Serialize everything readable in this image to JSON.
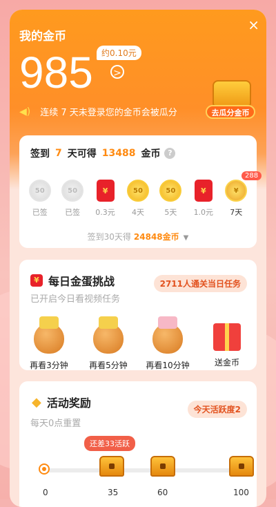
{
  "header": {
    "title": "我的金币",
    "coin_count": "985",
    "approx_value": "约0.10元",
    "arrow": ">",
    "warning": "连续 7 天未登录您的金币会被瓜分",
    "close": "×",
    "chest_button": "去瓜分金币"
  },
  "signin": {
    "prefix": "签到",
    "days": "7",
    "middle": "天可得",
    "amount": "13488",
    "unit": "金币",
    "help": "?",
    "badge": "288",
    "items": [
      {
        "icon": "50",
        "label": "已签"
      },
      {
        "icon": "50",
        "label": "已签"
      },
      {
        "icon": "¥",
        "label": "0.3元"
      },
      {
        "icon": "50",
        "label": "4天"
      },
      {
        "icon": "50",
        "label": "5天"
      },
      {
        "icon": "¥",
        "label": "1.0元"
      },
      {
        "icon": "¥",
        "label": "7天"
      }
    ],
    "summary_prefix": "签到30天得",
    "summary_value": "24848金币"
  },
  "challenge": {
    "title": "每日金蛋挑战",
    "icon": "¥",
    "pill": "2711人通关当日任务",
    "subtitle": "已开启今日看视频任务",
    "items": [
      {
        "label": "再看3分钟"
      },
      {
        "label": "再看5分钟"
      },
      {
        "label": "再看10分钟"
      },
      {
        "label": "送金币"
      }
    ]
  },
  "activity": {
    "title": "活动奖励",
    "pill": "今天活跃度2",
    "subtitle": "每天0点重置",
    "tooltip": "还差33活跃",
    "milestones": [
      "0",
      "35",
      "60",
      "100"
    ]
  },
  "colors": {
    "accent": "#ff8a10",
    "hero": "#ff9a1e",
    "red": "#e8222a"
  }
}
